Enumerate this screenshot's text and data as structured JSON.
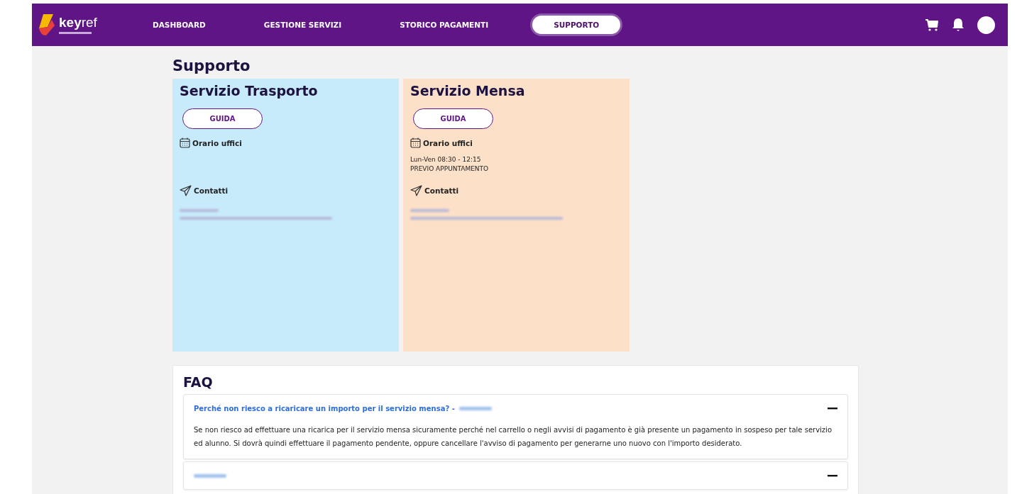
{
  "brand": {
    "name_bold": "key",
    "name_light": "ref"
  },
  "nav": [
    {
      "label": "DASHBOARD",
      "selected": false
    },
    {
      "label": "GESTIONE SERVIZI",
      "selected": false
    },
    {
      "label": "STORICO PAGAMENTI",
      "selected": false
    },
    {
      "label": "SUPPORTO",
      "selected": true
    }
  ],
  "page_title": "Supporto",
  "services": [
    {
      "title": "Servizio Trasporto",
      "color": "#c7ebfb",
      "guide_button": "GUIDA",
      "hours_label": "Orario uffici",
      "contacts_label": "Contatti"
    },
    {
      "title": "Servizio Mensa",
      "color": "#fce0c7",
      "guide_button": "GUIDA",
      "hours_label": "Orario uffici",
      "hours": [
        "Lun-Ven 08:30 - 12:15",
        "PREVIO APPUNTAMENTO"
      ],
      "contacts_label": "Contatti"
    }
  ],
  "faq": {
    "title": "FAQ",
    "items": [
      {
        "question": "Perché non riesco a ricaricare un importo per il servizio mensa? -",
        "expanded": true,
        "answer": "Se non riesco ad effettuare una ricarica per il servizio mensa sicuramente perché nel carrello o negli avvisi di pagamento è già presente un pagamento in sospeso per tale servizio ed alunno. Si dovrà quindi effettuare il pagamento pendente, oppure cancellare l'avviso di pagamento per generarne uno nuovo con l'importo desiderato."
      },
      {
        "expanded": true
      }
    ]
  }
}
